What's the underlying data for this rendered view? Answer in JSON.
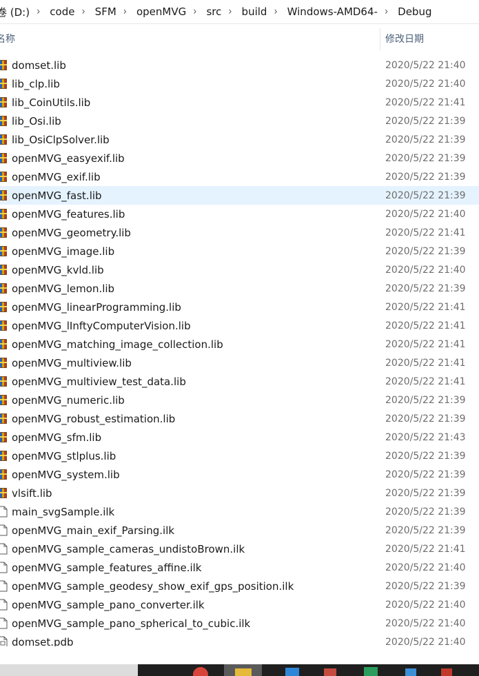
{
  "breadcrumb": [
    "卷 (D:)",
    "code",
    "SFM",
    "openMVG",
    "src",
    "build",
    "Windows-AMD64-",
    "Debug"
  ],
  "columns": {
    "name": "名称",
    "date": "修改日期"
  },
  "files": [
    {
      "name": "domset.lib",
      "date": "2020/5/22 21:40",
      "type": "lib"
    },
    {
      "name": "lib_clp.lib",
      "date": "2020/5/22 21:40",
      "type": "lib"
    },
    {
      "name": "lib_CoinUtils.lib",
      "date": "2020/5/22 21:41",
      "type": "lib"
    },
    {
      "name": "lib_Osi.lib",
      "date": "2020/5/22 21:39",
      "type": "lib"
    },
    {
      "name": "lib_OsiClpSolver.lib",
      "date": "2020/5/22 21:39",
      "type": "lib"
    },
    {
      "name": "openMVG_easyexif.lib",
      "date": "2020/5/22 21:39",
      "type": "lib"
    },
    {
      "name": "openMVG_exif.lib",
      "date": "2020/5/22 21:39",
      "type": "lib"
    },
    {
      "name": "openMVG_fast.lib",
      "date": "2020/5/22 21:39",
      "type": "lib",
      "selected": true
    },
    {
      "name": "openMVG_features.lib",
      "date": "2020/5/22 21:40",
      "type": "lib"
    },
    {
      "name": "openMVG_geometry.lib",
      "date": "2020/5/22 21:41",
      "type": "lib"
    },
    {
      "name": "openMVG_image.lib",
      "date": "2020/5/22 21:39",
      "type": "lib"
    },
    {
      "name": "openMVG_kvld.lib",
      "date": "2020/5/22 21:40",
      "type": "lib"
    },
    {
      "name": "openMVG_lemon.lib",
      "date": "2020/5/22 21:39",
      "type": "lib"
    },
    {
      "name": "openMVG_linearProgramming.lib",
      "date": "2020/5/22 21:41",
      "type": "lib"
    },
    {
      "name": "openMVG_lInftyComputerVision.lib",
      "date": "2020/5/22 21:41",
      "type": "lib"
    },
    {
      "name": "openMVG_matching_image_collection.lib",
      "date": "2020/5/22 21:41",
      "type": "lib"
    },
    {
      "name": "openMVG_multiview.lib",
      "date": "2020/5/22 21:41",
      "type": "lib"
    },
    {
      "name": "openMVG_multiview_test_data.lib",
      "date": "2020/5/22 21:41",
      "type": "lib"
    },
    {
      "name": "openMVG_numeric.lib",
      "date": "2020/5/22 21:39",
      "type": "lib"
    },
    {
      "name": "openMVG_robust_estimation.lib",
      "date": "2020/5/22 21:39",
      "type": "lib"
    },
    {
      "name": "openMVG_sfm.lib",
      "date": "2020/5/22 21:43",
      "type": "lib"
    },
    {
      "name": "openMVG_stlplus.lib",
      "date": "2020/5/22 21:39",
      "type": "lib"
    },
    {
      "name": "openMVG_system.lib",
      "date": "2020/5/22 21:39",
      "type": "lib"
    },
    {
      "name": "vlsift.lib",
      "date": "2020/5/22 21:39",
      "type": "lib"
    },
    {
      "name": "main_svgSample.ilk",
      "date": "2020/5/22 21:39",
      "type": "ilk"
    },
    {
      "name": "openMVG_main_exif_Parsing.ilk",
      "date": "2020/5/22 21:39",
      "type": "ilk"
    },
    {
      "name": "openMVG_sample_cameras_undistoBrown.ilk",
      "date": "2020/5/22 21:41",
      "type": "ilk"
    },
    {
      "name": "openMVG_sample_features_affine.ilk",
      "date": "2020/5/22 21:40",
      "type": "ilk"
    },
    {
      "name": "openMVG_sample_geodesy_show_exif_gps_position.ilk",
      "date": "2020/5/22 21:39",
      "type": "ilk"
    },
    {
      "name": "openMVG_sample_pano_converter.ilk",
      "date": "2020/5/22 21:40",
      "type": "ilk"
    },
    {
      "name": "openMVG_sample_pano_spherical_to_cubic.ilk",
      "date": "2020/5/22 21:40",
      "type": "ilk"
    },
    {
      "name": "domset.pdb",
      "date": "2020/5/22 21:40",
      "type": "pdb"
    }
  ],
  "icons": {
    "lib": "library-file-icon",
    "ilk": "blank-file-icon",
    "pdb": "document-file-icon"
  },
  "colors": {
    "selected_row": "#e5f3ff",
    "header_text": "#4c607a",
    "date_text": "#6d6d6d"
  }
}
